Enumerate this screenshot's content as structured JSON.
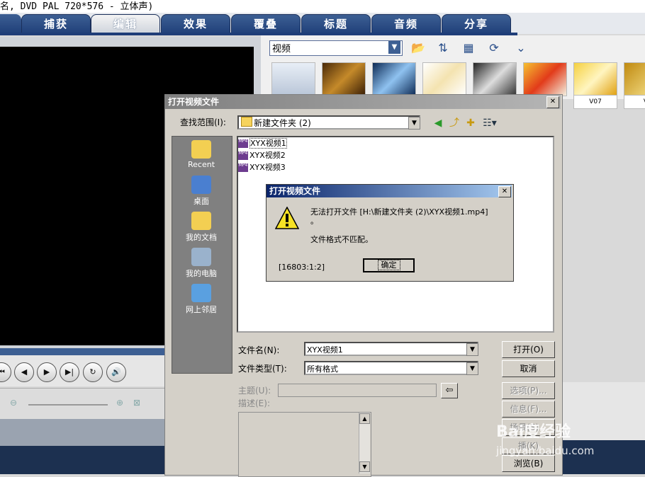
{
  "window": {
    "title_fragment": "名, DVD PAL 720*576 - 立体声)"
  },
  "main_tabs": [
    {
      "label": "捕获",
      "active": false
    },
    {
      "label": "编辑",
      "active": true
    },
    {
      "label": "效果",
      "active": false
    },
    {
      "label": "覆叠",
      "active": false
    },
    {
      "label": "标题",
      "active": false
    },
    {
      "label": "音频",
      "active": false
    },
    {
      "label": "分享",
      "active": false
    }
  ],
  "library": {
    "category": "视频",
    "icons": [
      "open-folder-icon",
      "sort-icon",
      "library-manager-icon",
      "refresh-icon",
      "expand-icon"
    ],
    "thumbs": [
      {
        "label": ""
      },
      {
        "label": ""
      },
      {
        "label": ""
      },
      {
        "label": ""
      },
      {
        "label": ""
      },
      {
        "label": ""
      },
      {
        "label": "V07"
      },
      {
        "label": "V"
      }
    ]
  },
  "player": {
    "controls": [
      "start-icon",
      "prev-frame-icon",
      "play-icon",
      "next-frame-icon",
      "repeat-icon",
      "volume-icon"
    ]
  },
  "open_dialog": {
    "title": "打开视频文件",
    "look_in_label": "查找范围(I):",
    "look_in_value": "新建文件夹 (2)",
    "places": [
      {
        "label": "Recent",
        "icon": "recent-icon"
      },
      {
        "label": "桌面",
        "icon": "desktop-icon"
      },
      {
        "label": "我的文档",
        "icon": "my-documents-icon"
      },
      {
        "label": "我的电脑",
        "icon": "my-computer-icon"
      },
      {
        "label": "网上邻居",
        "icon": "network-icon"
      }
    ],
    "files": [
      {
        "name": "XYX视频1",
        "selected": true
      },
      {
        "name": "XYX视频2",
        "selected": false
      },
      {
        "name": "XYX视频3",
        "selected": false
      }
    ],
    "file_name_label": "文件名(N):",
    "file_name_value": "XYX视频1",
    "file_type_label": "文件类型(T):",
    "file_type_value": "所有格式",
    "subject_label": "主题(U):",
    "description_label": "描述(E):",
    "buttons": {
      "open": "打开(O)",
      "cancel": "取消",
      "options": "选项(P)...",
      "info": "信息(F)...",
      "scene": "场景(S)...",
      "play": "播(K)",
      "browse": "浏览(B)"
    }
  },
  "error_dialog": {
    "title": "打开视频文件",
    "message_line1": "无法打开文件 [H:\\新建文件夹 (2)\\XYX视频1.mp4]",
    "message_line1b": "。",
    "message_line2": "文件格式不匹配。",
    "code": "[16803:1:2]",
    "ok_label": "确定"
  },
  "watermark": {
    "brand": "Bai度经验",
    "url": "jingyan.baidu.com"
  }
}
